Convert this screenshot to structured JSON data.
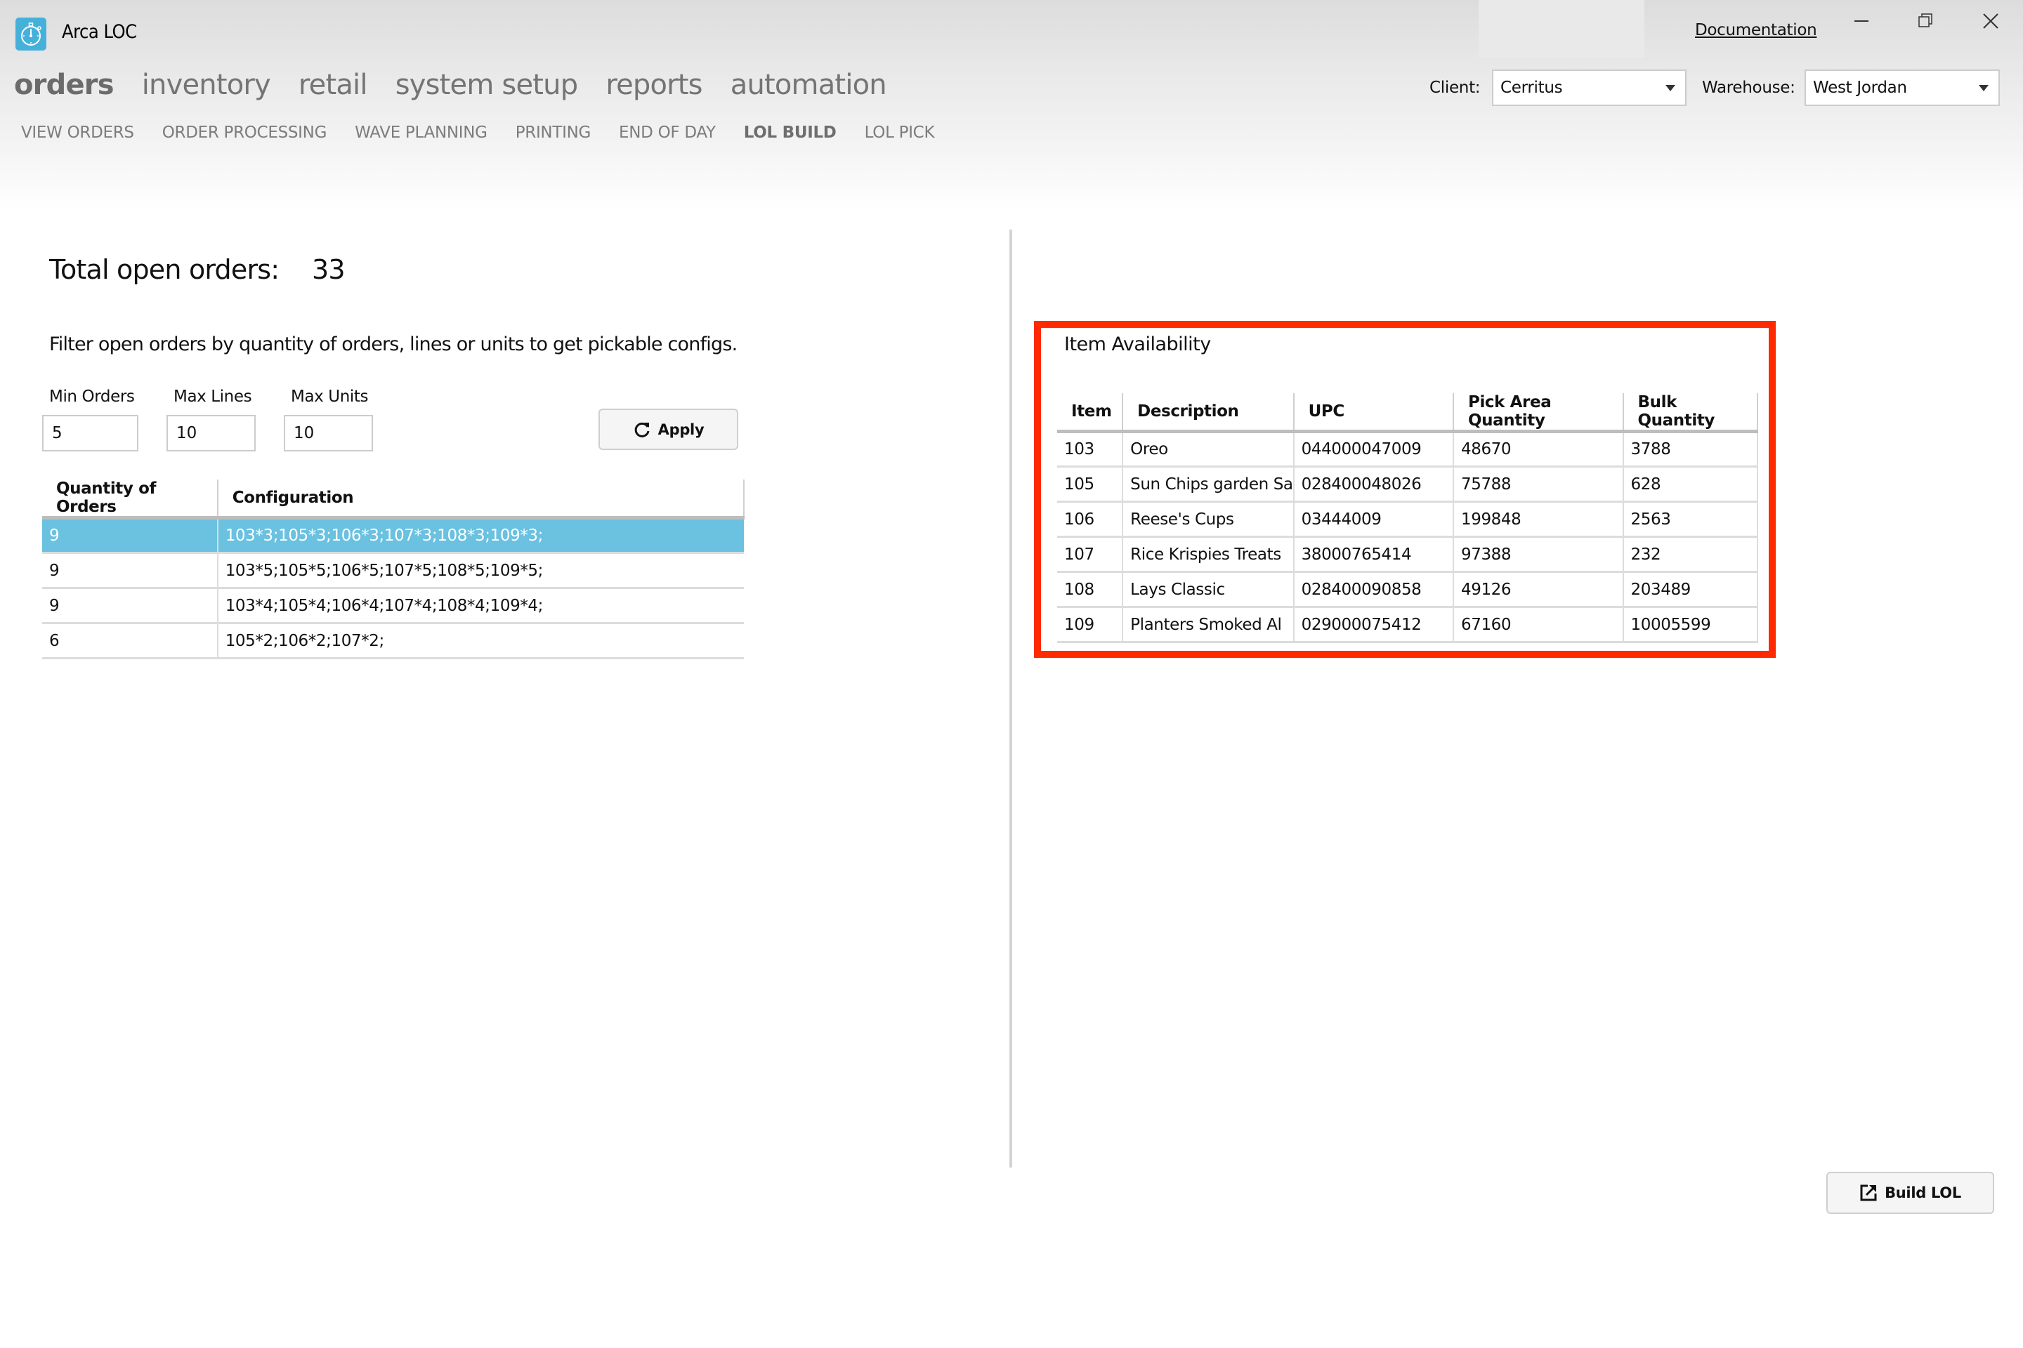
{
  "app": {
    "title": "Arca LOC",
    "logo_icon": "stopwatch-icon",
    "accent_color": "#45b1da"
  },
  "header": {
    "documentation_link": "Documentation",
    "window_controls": [
      "minimize-icon",
      "restore-icon",
      "close-icon"
    ],
    "client_label": "Client:",
    "client_value": "Cerritus",
    "warehouse_label": "Warehouse:",
    "warehouse_value": "West Jordan"
  },
  "main_nav": [
    {
      "label": "orders",
      "active": true
    },
    {
      "label": "inventory",
      "active": false
    },
    {
      "label": "retail",
      "active": false
    },
    {
      "label": "system setup",
      "active": false
    },
    {
      "label": "reports",
      "active": false
    },
    {
      "label": "automation",
      "active": false
    }
  ],
  "sub_nav": [
    {
      "label": "VIEW ORDERS",
      "active": false
    },
    {
      "label": "ORDER PROCESSING",
      "active": false
    },
    {
      "label": "WAVE PLANNING",
      "active": false
    },
    {
      "label": "PRINTING",
      "active": false
    },
    {
      "label": "END OF DAY",
      "active": false
    },
    {
      "label": "LOL BUILD",
      "active": true
    },
    {
      "label": "LOL PICK",
      "active": false
    }
  ],
  "left_panel": {
    "total_label": "Total open orders:",
    "total_value": "33",
    "filter_description": "Filter open orders by quantity of orders, lines or units to get pickable configs.",
    "fields": [
      {
        "label": "Min Orders",
        "value": "5"
      },
      {
        "label": "Max Lines",
        "value": "10"
      },
      {
        "label": "Max Units",
        "value": "10"
      }
    ],
    "apply_label": "Apply",
    "apply_icon": "refresh-icon",
    "config_table": {
      "columns": [
        "Quantity of Orders",
        "Configuration"
      ],
      "rows": [
        {
          "qty": "9",
          "config": "103*3;105*3;106*3;107*3;108*3;109*3;",
          "selected": true
        },
        {
          "qty": "9",
          "config": "103*5;105*5;106*5;107*5;108*5;109*5;",
          "selected": false
        },
        {
          "qty": "9",
          "config": "103*4;105*4;106*4;107*4;108*4;109*4;",
          "selected": false
        },
        {
          "qty": "6",
          "config": "105*2;106*2;107*2;",
          "selected": false
        }
      ],
      "selected_color": "#6ac1e0"
    }
  },
  "right_panel": {
    "title": "Item Availability",
    "highlight_color": "#ff2a00",
    "columns": [
      "Item",
      "Description",
      "UPC",
      "Pick Area Quantity",
      "Bulk Quantity"
    ],
    "rows": [
      [
        "103",
        "Oreo",
        "044000047009",
        "48670",
        "3788"
      ],
      [
        "105",
        "Sun Chips garden Sa",
        "028400048026",
        "75788",
        "628"
      ],
      [
        "106",
        "Reese's Cups",
        "03444009",
        "199848",
        "2563"
      ],
      [
        "107",
        "Rice Krispies Treats",
        "38000765414",
        "97388",
        "232"
      ],
      [
        "108",
        "Lays Classic",
        "028400090858",
        "49126",
        "203489"
      ],
      [
        "109",
        "Planters Smoked Al",
        "029000075412",
        "67160",
        "10005599"
      ]
    ]
  },
  "footer": {
    "build_label": "Build LOL",
    "build_icon": "external-link-icon"
  }
}
